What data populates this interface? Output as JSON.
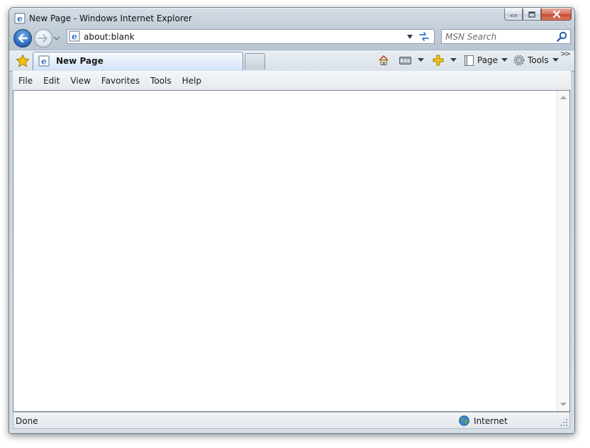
{
  "window": {
    "title": "New Page - Windows Internet Explorer"
  },
  "navigation": {
    "address": "about:blank",
    "search_placeholder": "MSN Search"
  },
  "tabs": [
    {
      "label": "New Page",
      "active": true
    }
  ],
  "command_bar": {
    "page_label": "Page",
    "tools_label": "Tools",
    "rss_text": "RSS",
    "more": ">>"
  },
  "menu": [
    "File",
    "Edit",
    "View",
    "Favorites",
    "Tools",
    "Help"
  ],
  "status": {
    "text": "Done",
    "zone": "Internet"
  },
  "colors": {
    "back_button": "#2f6fc0",
    "close_button": "#c24a32",
    "favorites_star": "#f5c400"
  }
}
